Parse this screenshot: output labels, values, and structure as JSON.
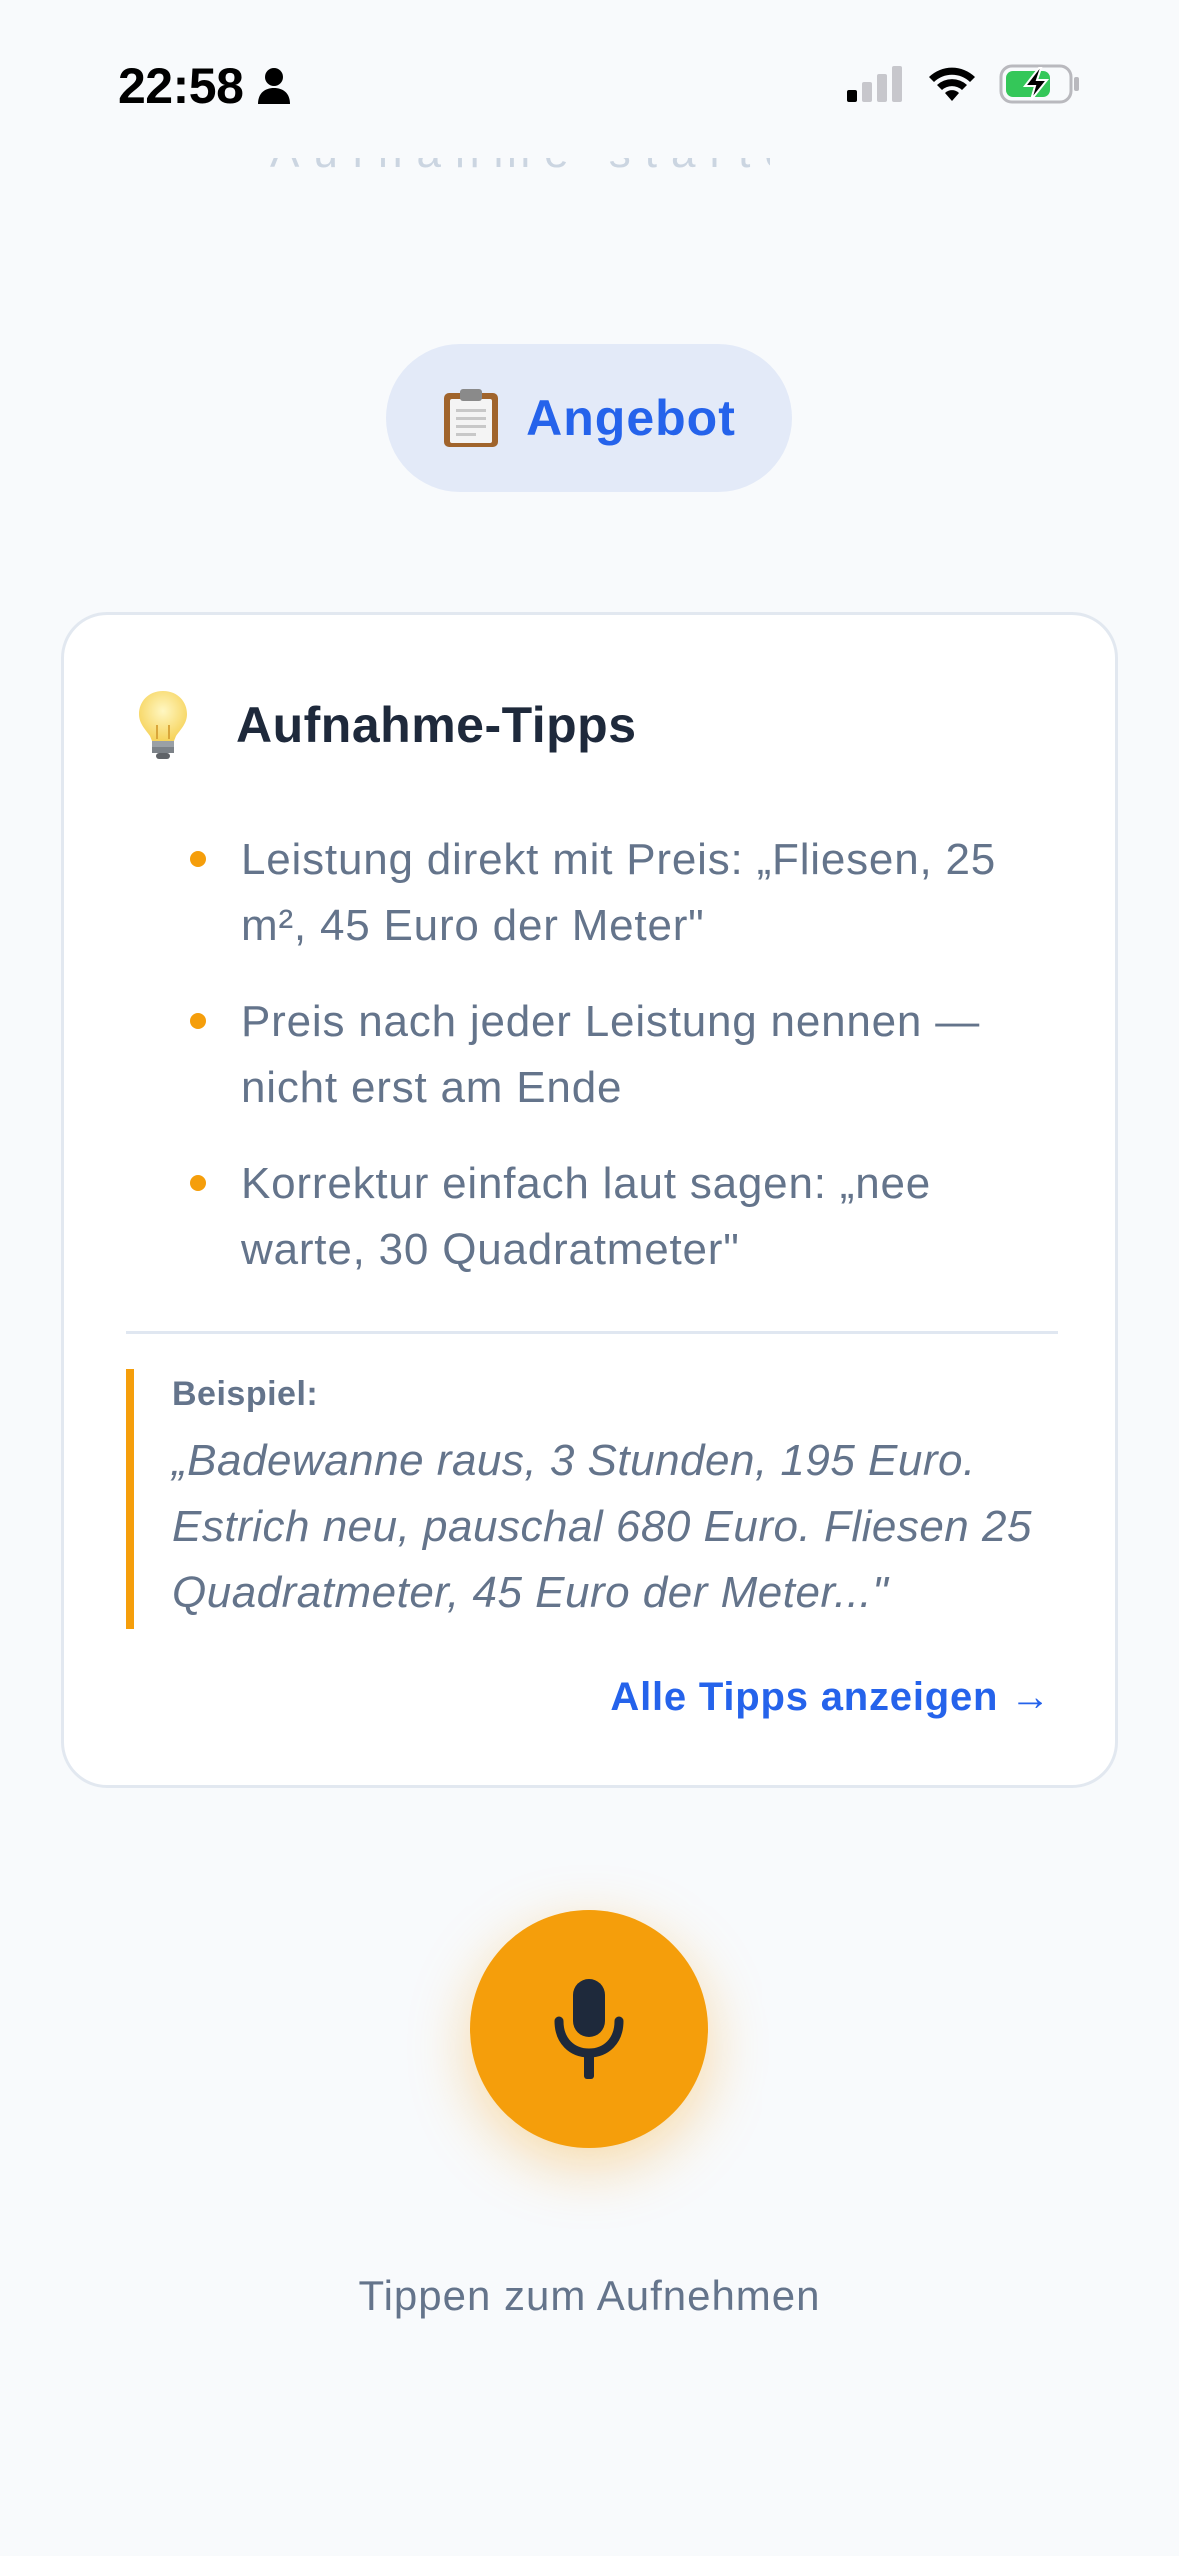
{
  "status_bar": {
    "time": "22:58",
    "icons": [
      "person-icon",
      "cellular-signal-icon",
      "wifi-icon",
      "battery-charging-icon"
    ]
  },
  "scroll_remnant": "Aufnahme starten oder",
  "chip": {
    "emoji": "clipboard-icon",
    "label": "Angebot"
  },
  "tips": {
    "icon": "lightbulb-icon",
    "title": "Aufnahme-Tipps",
    "items": [
      "Leistung direkt mit Preis: „Fliesen, 25 m², 45 Euro der Meter\"",
      "Preis nach jeder Leistung nennen — nicht erst am Ende",
      "Korrektur einfach laut sagen: „nee warte, 30 Quadratmeter\""
    ],
    "example_label": "Beispiel:",
    "example_text": "„Badewanne raus, 3 Stunden, 195 Euro. Estrich neu, pauschal 680 Euro. Fliesen 25 Quadratmeter, 45 Euro der Meter...\"",
    "all_tips_link": "Alle Tipps anzeigen →"
  },
  "record": {
    "icon": "microphone-icon",
    "hint": "Tippen zum Aufnehmen"
  },
  "colors": {
    "background": "#f8fafc",
    "accent": "#f59e0b",
    "link_blue": "#2563eb",
    "chip_bg": "#e3eaf8",
    "text_muted": "#64748b",
    "text_dark": "#1e293b"
  }
}
